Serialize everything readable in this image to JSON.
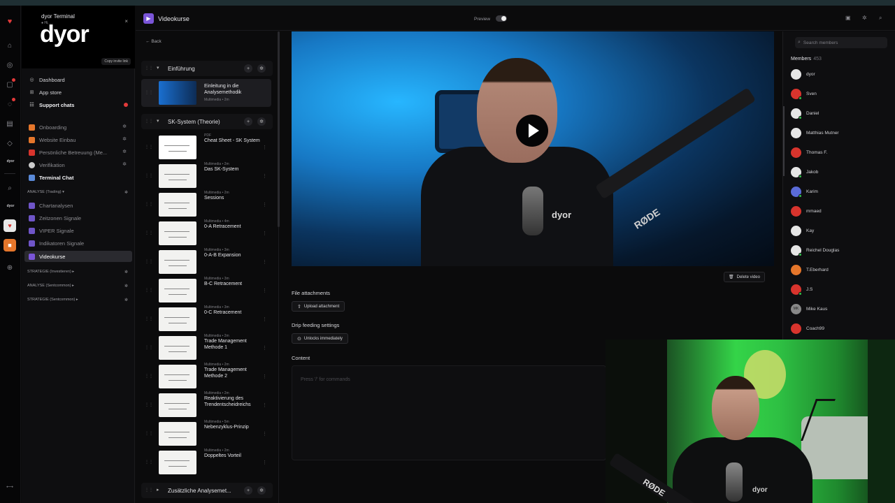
{
  "rail": {
    "items": [
      "home-icon",
      "compass-icon",
      "notification-icon",
      "chat-icon",
      "calendar-icon",
      "tag-icon",
      "search-icon"
    ],
    "brand": "dyor",
    "brand2": "dyor"
  },
  "sidebar": {
    "workspace_name": "dyor Terminal",
    "workspace_sub": "● Hi, ...",
    "logo_text": "dyor",
    "copy_button": "Copy invite link",
    "top_items": [
      {
        "label": "Dashboard"
      },
      {
        "label": "App store"
      },
      {
        "label": "Support chats"
      }
    ],
    "channels": [
      {
        "label": "Onboarding",
        "color": "#e5762b"
      },
      {
        "label": "Website Einbau",
        "color": "#e5762b"
      },
      {
        "label": "Persönliche Betreuung (Me...",
        "color": "#d8342d"
      },
      {
        "label": "Verifikation",
        "color": "#cccccc"
      },
      {
        "label": "Terminal Chat",
        "color": "#5a8ad8"
      }
    ],
    "group1": "ANALYSE (Trading)",
    "group1_items": [
      {
        "label": "Chartanalysen"
      },
      {
        "label": "Zeitzonen Signale"
      },
      {
        "label": "VIPER Signale"
      },
      {
        "label": "Indikatoren Signale"
      },
      {
        "label": "Videokurse"
      }
    ],
    "groups_collapsed": [
      "STRATEGIE (Investieren)",
      "ANALYSE (Sentcommon)",
      "STRATEGIE (Sentcommon)"
    ]
  },
  "header": {
    "title": "Videokurse",
    "preview_label": "Preview"
  },
  "course": {
    "back_label": "Back",
    "section1": "Einführung",
    "intro_lesson": {
      "title": "Einleitung in die Analysemethodik",
      "sub": "Multimedia • 2m"
    },
    "section2": "SK-System (Theorie)",
    "lessons": [
      {
        "title": "Cheat Sheet - SK System",
        "sub": "PDF"
      },
      {
        "title": "Das SK-System",
        "sub": "Multimedia • 2m"
      },
      {
        "title": "Sessions",
        "sub": "Multimedia • 2m"
      },
      {
        "title": "0-A Retracement",
        "sub": "Multimedia • 4m"
      },
      {
        "title": "0-A-B Expansion",
        "sub": "Multimedia • 3m"
      },
      {
        "title": "B-C Retracement",
        "sub": "Multimedia • 3m"
      },
      {
        "title": "0-C Retracement",
        "sub": "Multimedia • 3m"
      },
      {
        "title": "Trade Management Methode 1",
        "sub": "Multimedia • 2m"
      },
      {
        "title": "Trade Management Methode 2",
        "sub": "Multimedia • 2m"
      },
      {
        "title": "Reaktivierung des Trendentscheidreichs",
        "sub": "Multimedia • 2m"
      },
      {
        "title": "Nebenzyklus-Prinzip",
        "sub": "Multimedia • 5m"
      },
      {
        "title": "Doppeltes Vorteil",
        "sub": "Multimedia • 2m"
      }
    ],
    "section3": "Zusätzliche Analysemet..."
  },
  "main": {
    "video_logo": "dyor",
    "video_brand": "RØDE",
    "delete_label": "Delete video",
    "file_attachments_label": "File attachments",
    "upload_label": "Upload attachment",
    "drip_label": "Drip feeding settings",
    "unlock_label": "Unlocks immediately",
    "content_label": "Content",
    "content_placeholder": "Press '/' for commands"
  },
  "members": {
    "search_placeholder": "Search members",
    "title": "Members",
    "count": "453",
    "list": [
      {
        "name": "dyor",
        "color": "#e6e6e6",
        "online": false
      },
      {
        "name": "Sven",
        "color": "#d8342d",
        "online": true
      },
      {
        "name": "Daniel",
        "color": "#e6e6e6",
        "online": true
      },
      {
        "name": "Matthias Mutner",
        "color": "#e6e6e6",
        "online": false
      },
      {
        "name": "Thomas F.",
        "color": "#d8342d",
        "online": false
      },
      {
        "name": "Jakob",
        "color": "#e6e6e6",
        "online": true
      },
      {
        "name": "Karim",
        "color": "#5a6bd8",
        "online": true
      },
      {
        "name": "mmaed",
        "color": "#d8342d",
        "online": false
      },
      {
        "name": "Kay",
        "color": "#e6e6e6",
        "online": false
      },
      {
        "name": "Reichel Douglas",
        "color": "#e6e6e6",
        "online": true
      },
      {
        "name": "T.Eberhard",
        "color": "#e5762b",
        "online": false
      },
      {
        "name": "J.S",
        "color": "#d8342d",
        "online": true
      },
      {
        "name": "Mike Kaus",
        "color": "#888888",
        "online": false,
        "initials": "MK"
      },
      {
        "name": "Coach99",
        "color": "#d8342d",
        "online": false
      }
    ]
  },
  "webcam": {
    "brand": "RØDE",
    "shirt_logo": "dyor"
  }
}
